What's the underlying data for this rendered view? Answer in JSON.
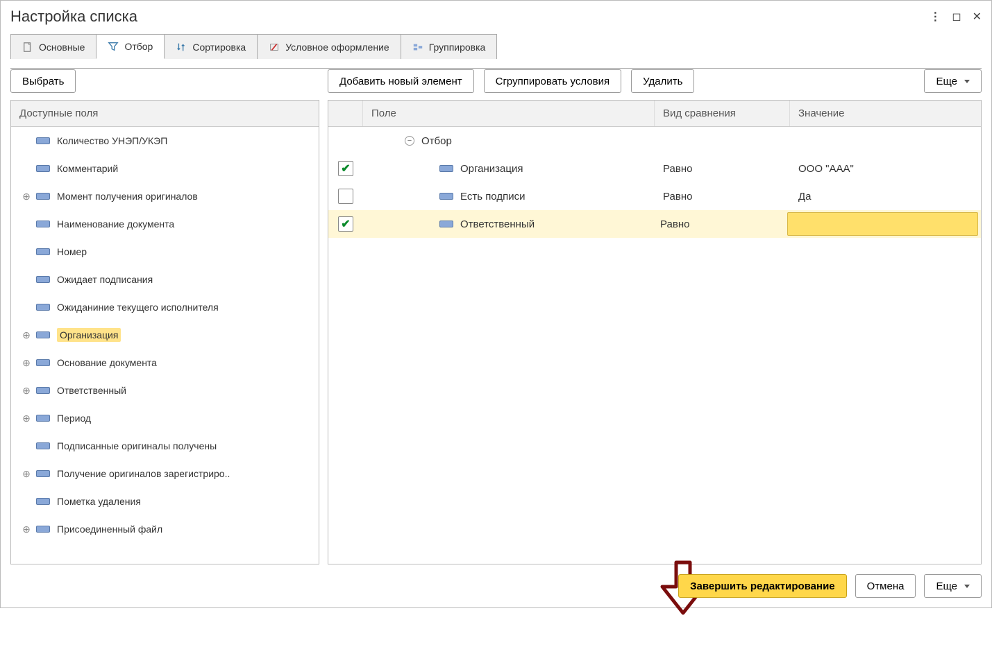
{
  "title": "Настройка списка",
  "tabs": {
    "main": "Основные",
    "filter": "Отбор",
    "sort": "Сортировка",
    "cond": "Условное оформление",
    "group": "Группировка"
  },
  "left": {
    "select_btn": "Выбрать",
    "header": "Доступные поля",
    "items": [
      {
        "label": "Количество УНЭП/УКЭП",
        "expandable": false
      },
      {
        "label": "Комментарий",
        "expandable": false
      },
      {
        "label": "Момент получения оригиналов",
        "expandable": true
      },
      {
        "label": "Наименование документа",
        "expandable": false
      },
      {
        "label": "Номер",
        "expandable": false
      },
      {
        "label": "Ожидает подписания",
        "expandable": false
      },
      {
        "label": "Ожиданиние текущего исполнителя",
        "expandable": false
      },
      {
        "label": "Организация",
        "expandable": true,
        "hl": true
      },
      {
        "label": "Основание документа",
        "expandable": true
      },
      {
        "label": "Ответственный",
        "expandable": true
      },
      {
        "label": "Период",
        "expandable": true
      },
      {
        "label": "Подписанные оригиналы получены",
        "expandable": false
      },
      {
        "label": "Получение оригиналов зарегистриро..",
        "expandable": true
      },
      {
        "label": "Пометка удаления",
        "expandable": false
      },
      {
        "label": "Присоединенный файл",
        "expandable": true
      }
    ]
  },
  "right": {
    "toolbar": {
      "add": "Добавить новый элемент",
      "group": "Сгруппировать условия",
      "del": "Удалить",
      "more": "Еще"
    },
    "headers": {
      "field": "Поле",
      "cmp": "Вид сравнения",
      "val": "Значение"
    },
    "group_label": "Отбор",
    "rows": [
      {
        "checked": true,
        "field": "Организация",
        "cmp": "Равно",
        "val": "ООО \"ААА\"",
        "sel": false
      },
      {
        "checked": false,
        "field": "Есть подписи",
        "cmp": "Равно",
        "val": "Да",
        "sel": false
      },
      {
        "checked": true,
        "field": "Ответственный",
        "cmp": "Равно",
        "val": "",
        "sel": true
      }
    ]
  },
  "footer": {
    "finish": "Завершить редактирование",
    "cancel": "Отмена",
    "more": "Еще"
  }
}
